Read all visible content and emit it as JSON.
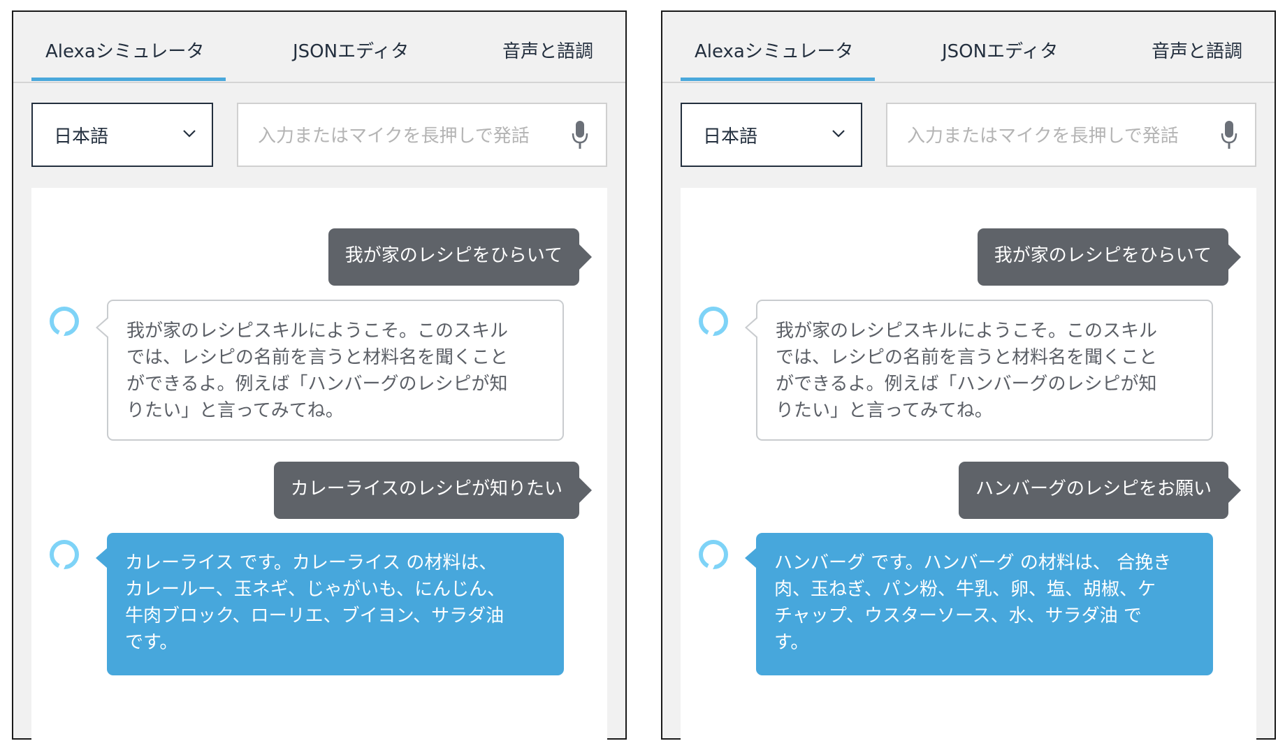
{
  "panels": [
    {
      "tabs": [
        "Alexaシミュレータ",
        "JSONエディタ",
        "音声と語調"
      ],
      "language": "日本語",
      "input_placeholder": "入力またはマイクを長押しで発話",
      "messages": {
        "user_1": "我が家のレシピをひらいて",
        "alexa_1": "我が家のレシピスキルにようこそ。このスキル\nでは、レシピの名前を言うと材料名を聞くこと\nができるよ。例えば「ハンバーグのレシピが知\nりたい」と言ってみてね。",
        "user_2": "カレーライスのレシピが知りたい",
        "alexa_2": "カレーライス です。カレーライス の材料は、\nカレールー、玉ネギ、じゃがいも、にんじん、\n牛肉ブロック、ローリエ、ブイヨン、サラダ油\nです。"
      }
    },
    {
      "tabs": [
        "Alexaシミュレータ",
        "JSONエディタ",
        "音声と語調"
      ],
      "language": "日本語",
      "input_placeholder": "入力またはマイクを長押しで発話",
      "messages": {
        "user_1": "我が家のレシピをひらいて",
        "alexa_1": "我が家のレシピスキルにようこそ。このスキル\nでは、レシピの名前を言うと材料名を聞くこと\nができるよ。例えば「ハンバーグのレシピが知\nりたい」と言ってみてね。",
        "user_2": "ハンバーグのレシピをお願い",
        "alexa_2": "ハンバーグ です。ハンバーグ の材料は、 合挽き\n肉、玉ねぎ、パン粉、牛乳、卵、塩、胡椒、ケ\nチャップ、ウスターソース、水、サラダ油 で\nす。"
      }
    }
  ],
  "colors": {
    "accent": "#4aa8db",
    "user_bubble": "#5f6369",
    "alexa_result_bubble": "#47a7dc",
    "alexa_ring": "#7ed3f7"
  },
  "icons": {
    "dropdown": "chevron-down-icon",
    "microphone": "microphone-icon",
    "alexa": "alexa-ring-icon"
  }
}
